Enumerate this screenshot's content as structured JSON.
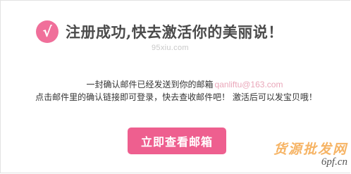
{
  "header": {
    "icon": "checkmark-icon",
    "icon_glyph": "√",
    "title": "注册成功,快去激活你的美丽说！"
  },
  "watermark_top": "95xiu.com",
  "message": {
    "line1_text": "一封确认邮件已经发送到你的邮箱",
    "email": "qanliftu@163.com",
    "line2_text": "点击邮件里的确认链接即可登录，快去查收邮件吧！  激活后可以发宝贝哦！"
  },
  "actions": {
    "view_email_label": "立即查看邮箱"
  },
  "brand_watermark": {
    "text": "货源批发网",
    "url": "6pf.cn"
  },
  "colors": {
    "accent_pink": "#ee5f8f",
    "title_gray": "#4b4b4b",
    "watermark_orange": "#f5a74b"
  }
}
